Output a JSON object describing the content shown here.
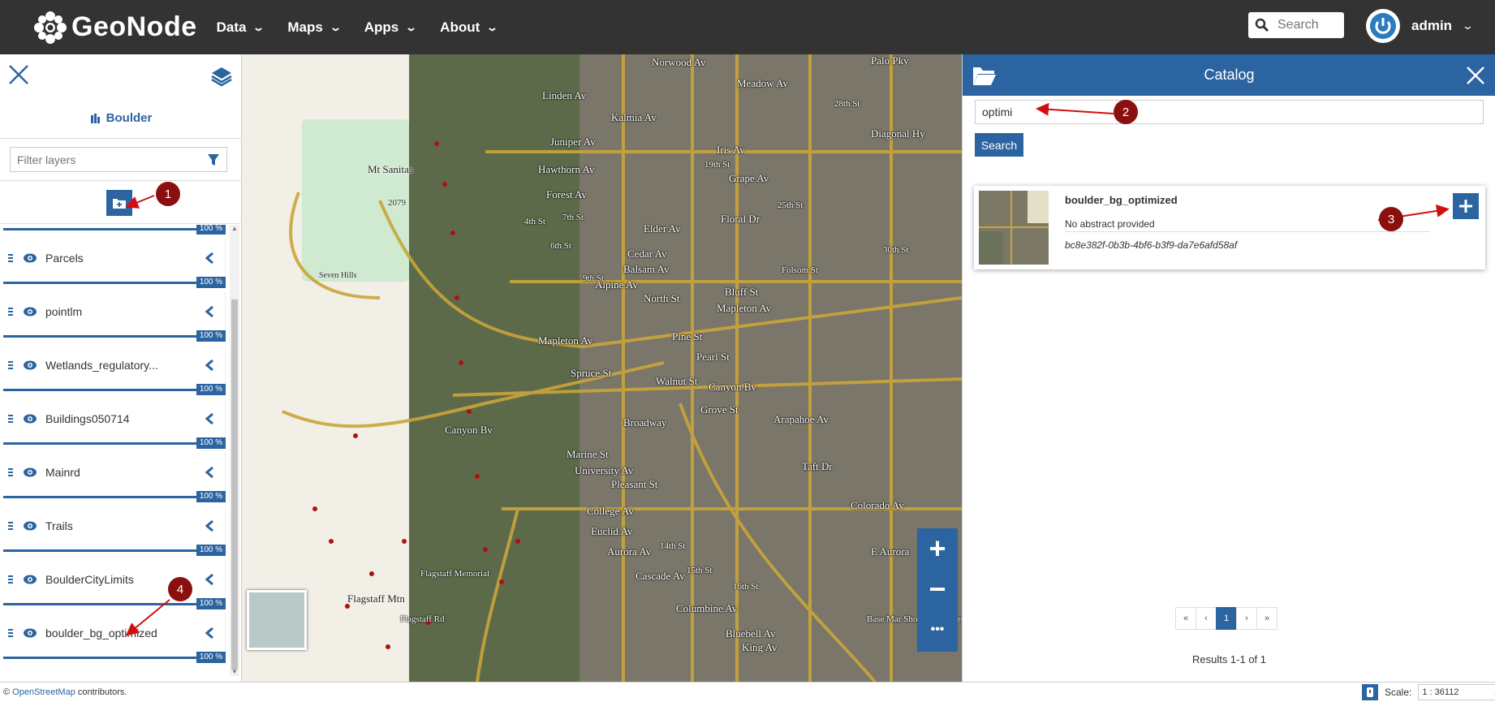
{
  "brand": {
    "name": "GeoNode"
  },
  "nav": {
    "items": [
      {
        "label": "Data"
      },
      {
        "label": "Maps"
      },
      {
        "label": "Apps"
      },
      {
        "label": "About"
      }
    ],
    "search_placeholder": "Search",
    "user": "admin"
  },
  "sidebar": {
    "map_title": "Boulder",
    "filter_placeholder": "Filter layers",
    "layers": [
      {
        "name": "Parcels",
        "opacity": "100 %"
      },
      {
        "name": "pointlm",
        "opacity": "100 %"
      },
      {
        "name": "Wetlands_regulatory...",
        "opacity": "100 %"
      },
      {
        "name": "Buildings050714",
        "opacity": "100 %"
      },
      {
        "name": "Mainrd",
        "opacity": "100 %"
      },
      {
        "name": "Trails",
        "opacity": "100 %"
      },
      {
        "name": "BoulderCityLimits",
        "opacity": "100 %"
      },
      {
        "name": "boulder_bg_optimized",
        "opacity": "100 %"
      }
    ],
    "top_partial_opacity": "100 %"
  },
  "map": {
    "labels": [
      "Norwood Av",
      "Meadow Av",
      "Palo Pky",
      "Linden Av",
      "Kalmia Av",
      "Juniper Av",
      "Hawthorn Av",
      "Iris Av",
      "Grape Av",
      "Diagonal Hy",
      "Forest Av",
      "Elder Av",
      "Floral Dr",
      "Cedar Av",
      "Balsam Av",
      "Alpine Av",
      "North St",
      "Bluff St",
      "Mapleton Av",
      "Pine St",
      "Pearl St",
      "Spruce St",
      "Walnut St",
      "Canyon Bv",
      "Grove St",
      "Arapahoe Av",
      "Broadway",
      "Marine St",
      "University Av",
      "Pleasant St",
      "College Av",
      "Euclid Av",
      "Aurora Av",
      "Cascade Av",
      "Columbine Av",
      "Bluebell Av",
      "King Av",
      "Colorado Av",
      "E Aurora",
      "Taft Dr",
      "Mt Sanitas",
      "2079",
      "Seven Hills",
      "Flagstaff Mtn",
      "Flagstaff Rd",
      "Canyon Bv",
      "4th St",
      "6th St",
      "7th St",
      "9th St",
      "19th St",
      "28th St",
      "30th St",
      "15th St",
      "14th St",
      "16th St",
      "25th St",
      "Folsom St",
      "Mapleton Av",
      "Flagstaff Memorial",
      "Base Mar Shopping Center"
    ],
    "zoom_in": "+",
    "zoom_out": "−",
    "more": "•••"
  },
  "catalog": {
    "title": "Catalog",
    "search_value": "optimi",
    "search_button": "Search",
    "record": {
      "title": "boulder_bg_optimized",
      "abstract": "No abstract provided",
      "id": "bc8e382f-0b3b-4bf6-b3f9-da7e6afd58af"
    },
    "pager": [
      "«",
      "‹",
      "1",
      "›",
      "»"
    ],
    "results": "Results 1-1 of 1"
  },
  "footer": {
    "copyright": "©",
    "osm_link": "OpenStreetMap",
    "contributors": " contributors.",
    "scale_label": "Scale:",
    "scale_value": "1 : 36112"
  },
  "annotations": [
    "1",
    "2",
    "3",
    "4"
  ],
  "colors": {
    "navbar": "#333333",
    "primary": "#2b64a0",
    "marker": "#8b0f0f"
  }
}
